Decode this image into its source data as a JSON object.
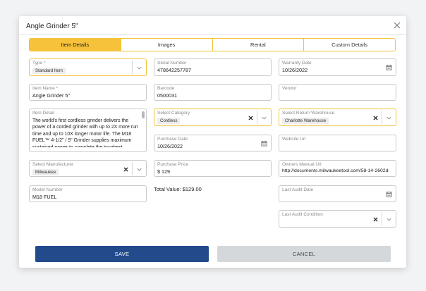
{
  "title": "Angle Grinder 5\"",
  "tabs": [
    {
      "label": "Item Details"
    },
    {
      "label": "Images"
    },
    {
      "label": "Rental"
    },
    {
      "label": "Custom Details"
    }
  ],
  "fields": {
    "type": {
      "label": "Type *",
      "value": "Standard Item"
    },
    "item_name": {
      "label": "Item Name *",
      "value": "Angle Grinder 5\""
    },
    "item_detail": {
      "label": "Item Detail",
      "value": "The world's first cordless grinder delivers the power of a corded grinder with up to 2X more run time and up to 10X longer motor life. The M18 FUEL™ 4-1/2\" / 5\" Grinder supplies maximum sustained power to complete the toughest"
    },
    "manufacturer": {
      "label": "Select Manufacturer",
      "value": "Milwaukee"
    },
    "model_number": {
      "label": "Model Number",
      "value": "M18 FUEL"
    },
    "serial_number": {
      "label": "Serial Number",
      "value": "478642257787"
    },
    "barcode": {
      "label": "Barcode",
      "value": "0500031"
    },
    "category": {
      "label": "Select Category",
      "value": "Cordless"
    },
    "purchase_date": {
      "label": "Purchase Date",
      "value": "10/26/2022"
    },
    "purchase_price": {
      "label": "Purchase Price",
      "value": "$ 129"
    },
    "total_value": "Total Value: $129.00",
    "warranty_date": {
      "label": "Warranty Date",
      "value": "10/26/2022"
    },
    "vendor": {
      "label": "Vendor",
      "value": ""
    },
    "return_warehouse": {
      "label": "Select Return Warehouse",
      "value": "Charlotte Warehouse"
    },
    "website_url": {
      "label": "Website Url",
      "value": ""
    },
    "owners_manual_url": {
      "label": "Owners Manual Url",
      "value": "http://documents.milwaukeetool.com/58-14-2602d:"
    },
    "last_audit_date": {
      "label": "Last Audit Date",
      "value": ""
    },
    "last_audit_condition": {
      "label": "Last Audit Condition",
      "value": ""
    }
  },
  "buttons": {
    "save": "SAVE",
    "cancel": "CANCEL"
  },
  "colors": {
    "accent": "#f5c23a",
    "primary": "#234b8c",
    "cancel": "#d5d8db"
  }
}
